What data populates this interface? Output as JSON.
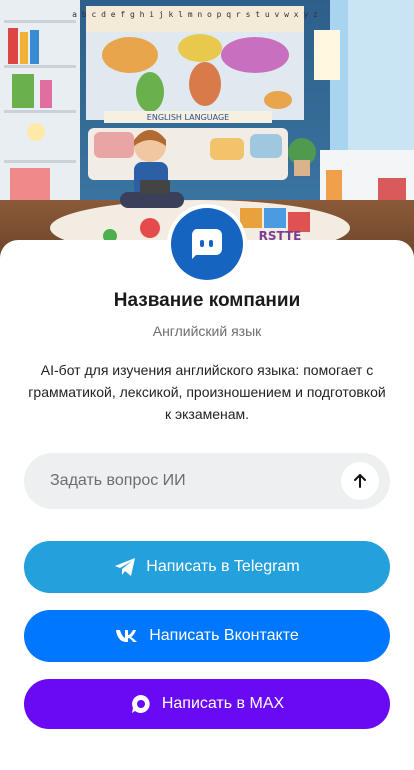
{
  "company": {
    "name": "Название компании",
    "category": "Английский язык",
    "description": "AI-бот для изучения английского языка: помогает с грамматикой, лексикой, произношением и подготовкой к экзаменам."
  },
  "hero": {
    "alphabet": "a b c d e f g h i j k l m n o p q r s t u v w x y z",
    "banner": "ENGLISH LANGUAGE",
    "blocks": "RSTTE"
  },
  "ask": {
    "placeholder": "Задать вопрос ИИ",
    "value": "",
    "send_icon": "arrow-up-icon"
  },
  "buttons": {
    "telegram": {
      "label": "Написать в Telegram",
      "icon": "telegram-icon",
      "color": "#24a0dc"
    },
    "vk": {
      "label": "Написать Вконтакте",
      "icon": "vk-icon",
      "color": "#0077ff"
    },
    "max": {
      "label": "Написать в MAX",
      "icon": "max-icon",
      "color": "#6a0af5"
    }
  },
  "colors": {
    "avatar": "#1565c0",
    "input_bg": "#eeeff1"
  }
}
